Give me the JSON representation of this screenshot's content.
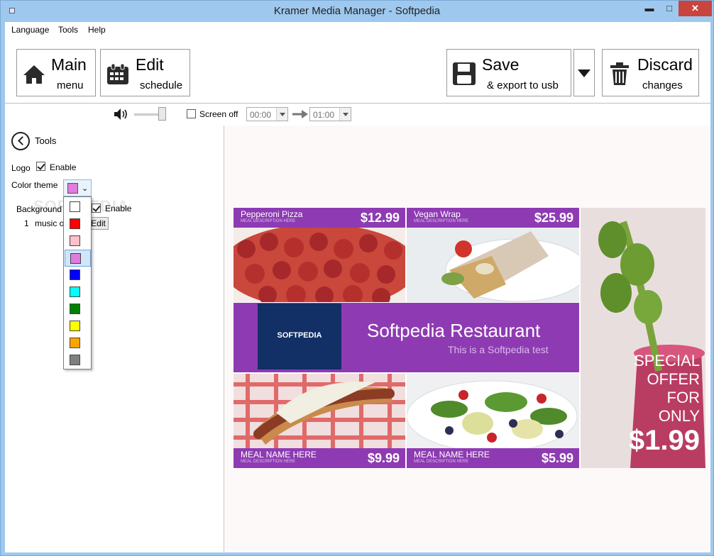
{
  "window": {
    "title": "Kramer Media Manager - Softpedia",
    "minimize": "▬",
    "maximize": "□",
    "close": "✕"
  },
  "menubar": [
    "Language",
    "Tools",
    "Help"
  ],
  "toolbar": {
    "main": {
      "line1": "Main",
      "line2": "menu"
    },
    "edit": {
      "line1": "Edit",
      "line2": "schedule"
    },
    "save": {
      "line1": "Save",
      "line2": "& export to usb"
    },
    "discard": {
      "line1": "Discard",
      "line2": "changes"
    }
  },
  "controls": {
    "screen_off_label": "Screen off",
    "screen_off_checked": false,
    "time_from": "00:00",
    "time_to": "01:00"
  },
  "left": {
    "section_title": "Tools",
    "logo_label": "Logo",
    "logo_enable_label": "Enable",
    "logo_enabled": true,
    "color_theme_label": "Color theme",
    "selected_color": "#e07be0",
    "background_label": "Background",
    "background_enable_label": "Enable",
    "background_enabled": true,
    "music_index": "1",
    "music_label": "music o",
    "edit_label": "Edit",
    "watermark": "SOFTPEDIA"
  },
  "color_options": [
    {
      "color": "#ffffff",
      "name": "white"
    },
    {
      "color": "#ff0000",
      "name": "red"
    },
    {
      "color": "#ffc0cb",
      "name": "pink"
    },
    {
      "color": "#e07be0",
      "name": "violet",
      "selected": true
    },
    {
      "color": "#0000ff",
      "name": "blue"
    },
    {
      "color": "#00ffff",
      "name": "cyan"
    },
    {
      "color": "#008000",
      "name": "green"
    },
    {
      "color": "#ffff00",
      "name": "yellow"
    },
    {
      "color": "#ffa500",
      "name": "orange"
    },
    {
      "color": "#808080",
      "name": "gray"
    }
  ],
  "preview": {
    "items": [
      {
        "name": "Pepperoni Pizza",
        "desc": "MEAL DESCRIPTION HERE",
        "price": "$12.99"
      },
      {
        "name": "Vegan Wrap",
        "desc": "MEAL DESCRIPTION HERE",
        "price": "$25.99"
      },
      {
        "name": "MEAL NAME HERE",
        "desc": "MEAL DESCRIPTION HERE",
        "price": "$9.99"
      },
      {
        "name": "MEAL NAME HERE",
        "desc": "MEAL DESCRIPTION HERE",
        "price": "$5.99"
      }
    ],
    "logo_text": "SOFTPEDIA",
    "restaurant_name": "Softpedia Restaurant",
    "restaurant_subtitle": "This is a Softpedia test",
    "offer": {
      "l1": "SPECIAL",
      "l2": "OFFER",
      "l3": "FOR",
      "l4": "ONLY",
      "price": "$1.99"
    },
    "theme_color": "#8e3bb3"
  }
}
